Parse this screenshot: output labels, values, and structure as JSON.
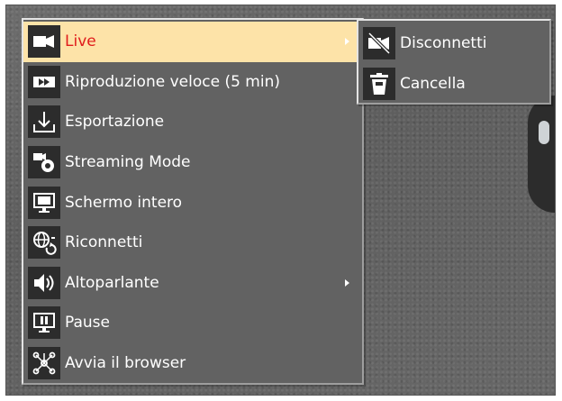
{
  "menu": {
    "items": [
      {
        "label": "Live",
        "icon": "video-camera-icon",
        "submenu": true,
        "active": true
      },
      {
        "label": "Riproduzione veloce (5 min)",
        "icon": "fast-playback-icon",
        "submenu": false
      },
      {
        "label": "Esportazione",
        "icon": "export-download-icon",
        "submenu": false
      },
      {
        "label": "Streaming Mode",
        "icon": "streaming-settings-icon",
        "submenu": false
      },
      {
        "label": "Schermo intero",
        "icon": "fullscreen-monitor-icon",
        "submenu": false
      },
      {
        "label": "Riconnetti",
        "icon": "reconnect-globe-icon",
        "submenu": false
      },
      {
        "label": "Altoparlante",
        "icon": "speaker-icon",
        "submenu": true
      },
      {
        "label": "Pause",
        "icon": "pause-icon",
        "submenu": false
      },
      {
        "label": "Avvia il browser",
        "icon": "browser-network-icon",
        "submenu": false
      }
    ]
  },
  "submenu": {
    "items": [
      {
        "label": "Disconnetti",
        "icon": "disconnect-camera-icon"
      },
      {
        "label": "Cancella",
        "icon": "trash-delete-icon"
      }
    ]
  },
  "colors": {
    "active_background": "#fde3a8",
    "active_text": "#e01c1c",
    "menu_background": "#626262"
  }
}
